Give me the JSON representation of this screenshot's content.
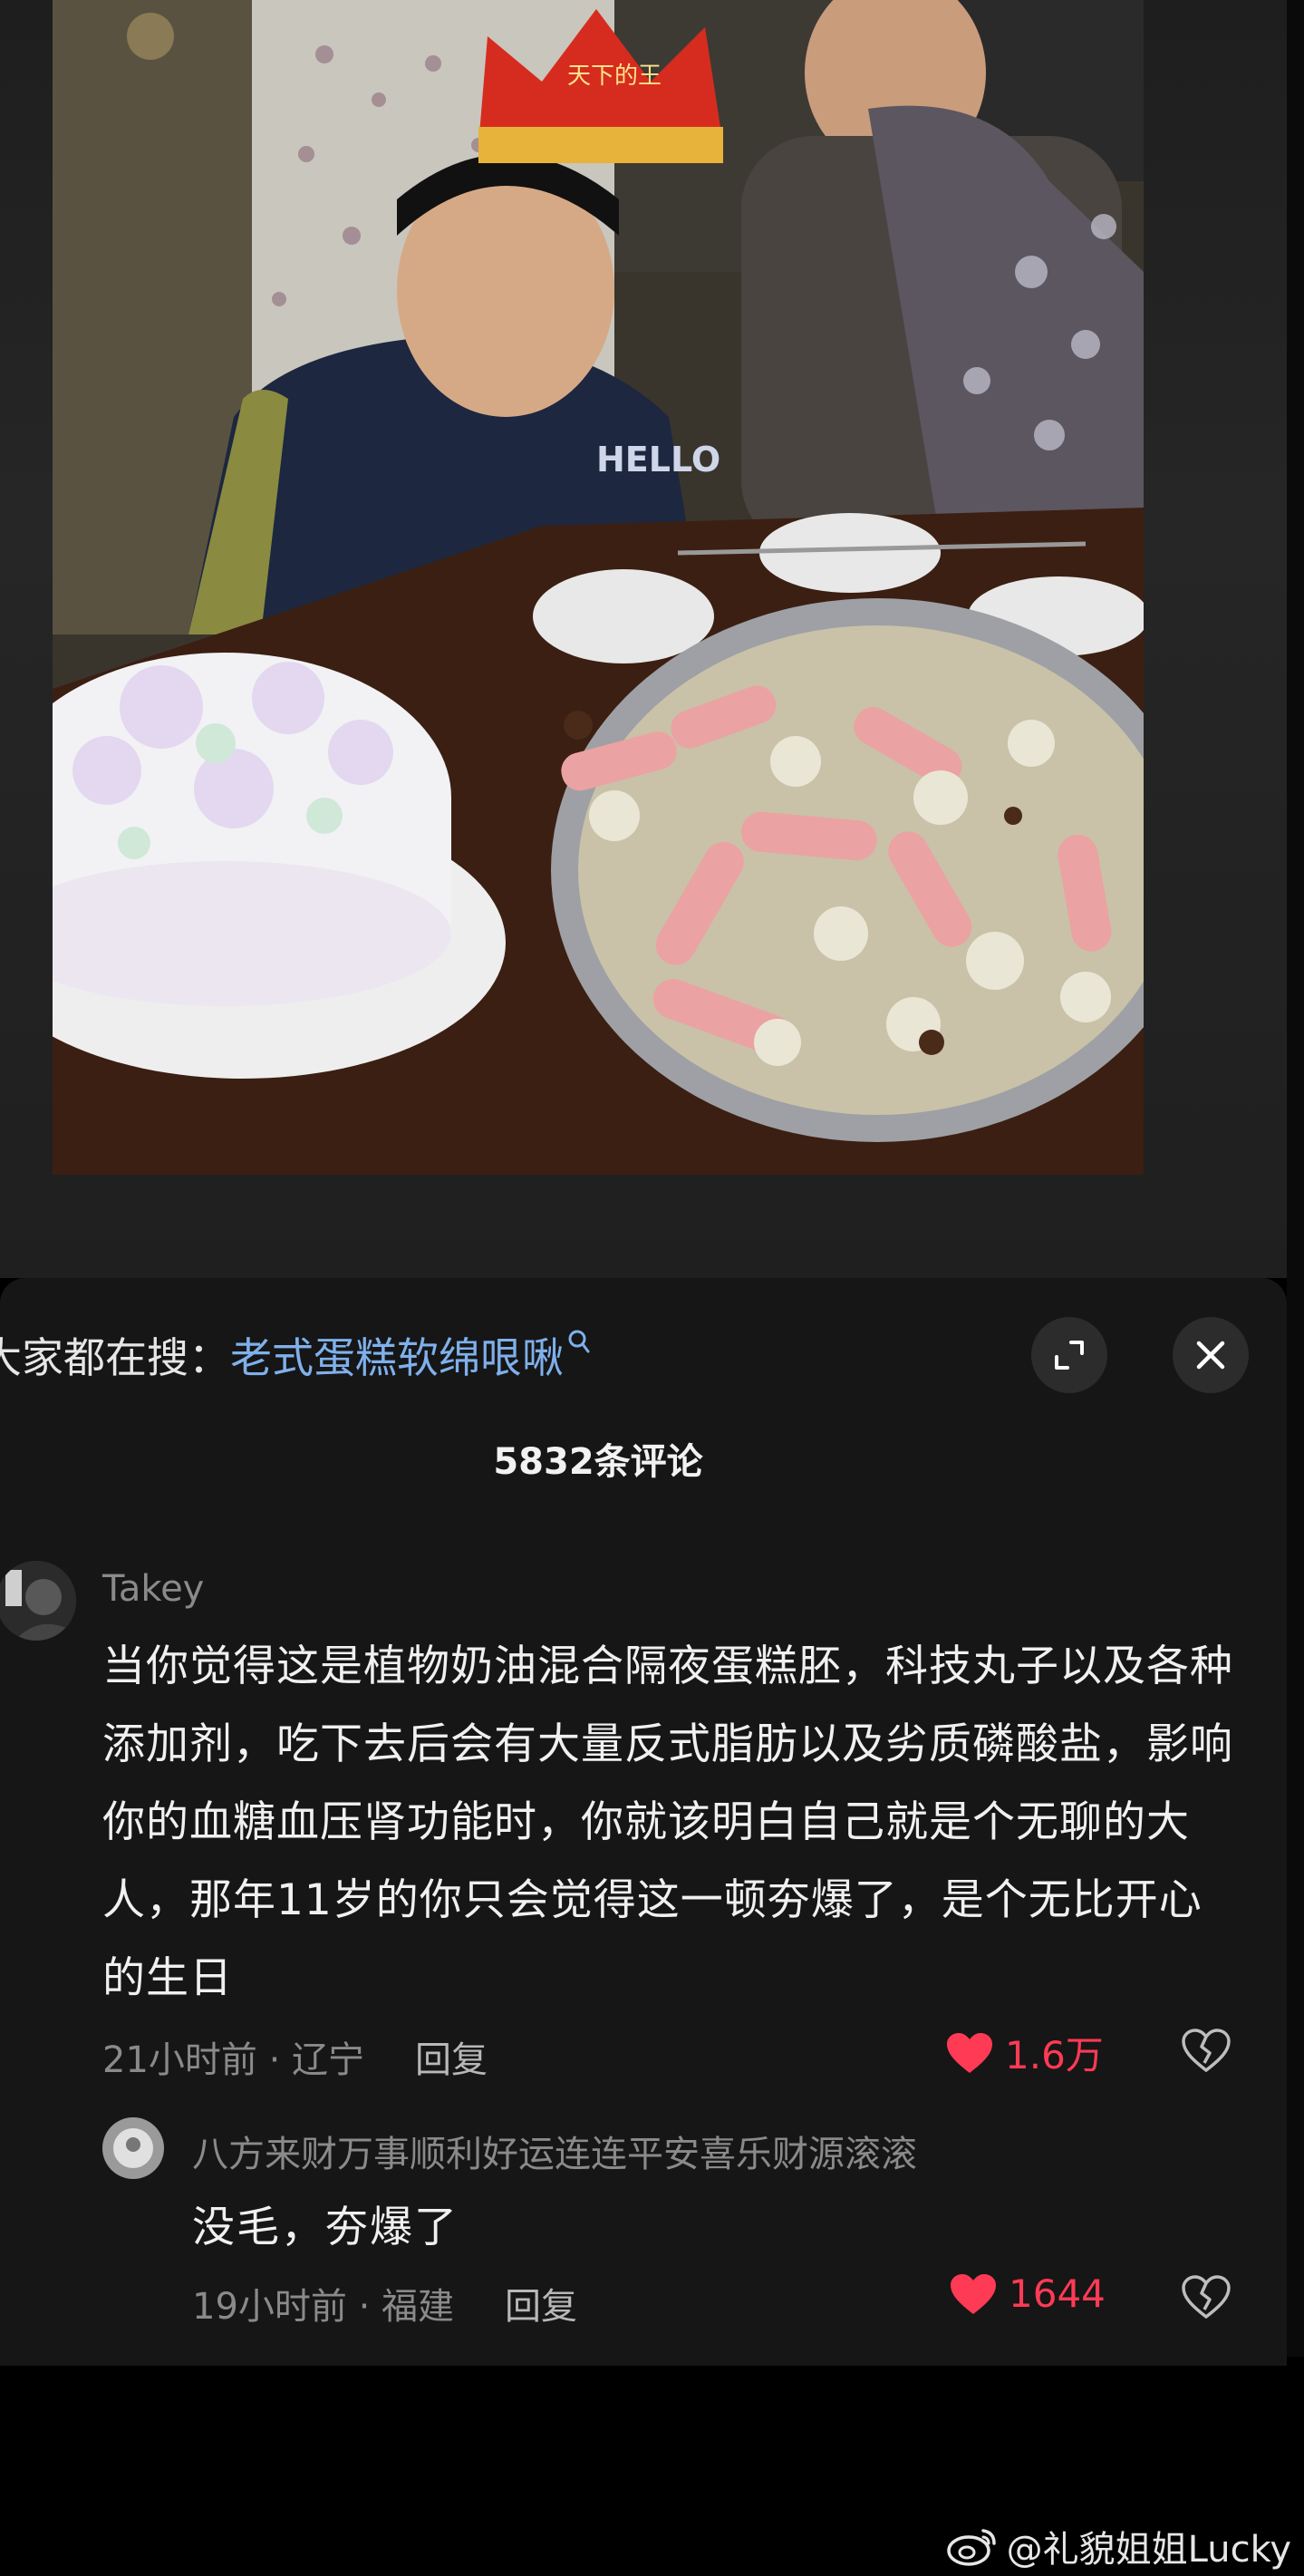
{
  "search": {
    "prefix": "大家都在搜：",
    "query": "老式蛋糕软绵哏啾"
  },
  "comments_header": {
    "count_label": "5832条评论"
  },
  "comments": [
    {
      "username": "Takey",
      "text": "当你觉得这是植物奶油混合隔夜蛋糕胚，科技丸子以及各种添加剂，吃下去后会有大量反式脂肪以及劣质磷酸盐，影响你的血糖血压肾功能时，你就该明白自己就是个无聊的大人，那年11岁的你只会觉得这一顿夯爆了，是个无比开心的生日",
      "time_location": "21小时前 · 辽宁",
      "reply_label": "回复",
      "likes": "1.6万"
    },
    {
      "username": "八方来财万事顺利好运连连平安喜乐财源滚滚",
      "text": "没毛，夯爆了",
      "time_location": "19小时前 · 福建",
      "reply_label": "回复",
      "likes": "1644"
    }
  ],
  "photo": {
    "hat_text": "天下的王"
  },
  "watermark": {
    "text": "@礼貌姐姐Lucky"
  },
  "colors": {
    "accent_link": "#7fb0ec",
    "like_red": "#ff3a55",
    "panel_bg": "#161616"
  },
  "icons": {
    "expand": "expand-icon",
    "close": "close-icon",
    "heart": "heart-icon",
    "dislike": "broken-heart-icon",
    "search": "search-icon",
    "weibo": "weibo-logo-icon"
  }
}
